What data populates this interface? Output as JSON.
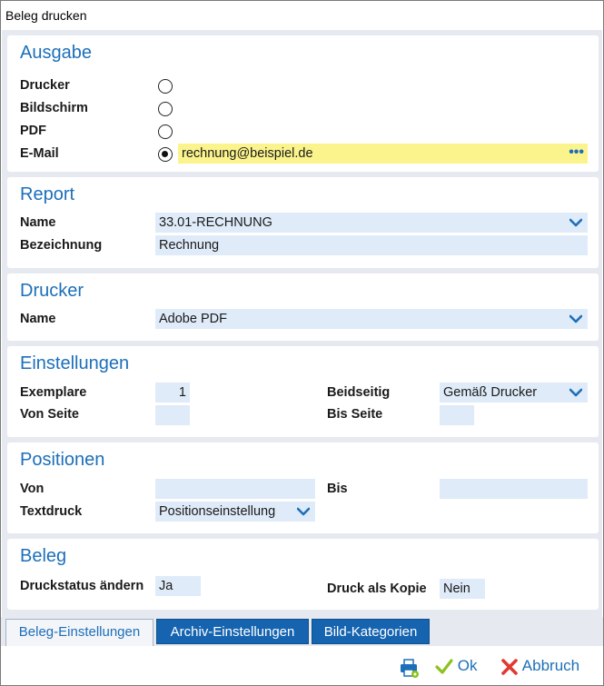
{
  "window": {
    "title": "Beleg drucken"
  },
  "ausgabe": {
    "title": "Ausgabe",
    "options": [
      {
        "label": "Drucker",
        "checked": false
      },
      {
        "label": "Bildschirm",
        "checked": false
      },
      {
        "label": "PDF",
        "checked": false
      },
      {
        "label": "E-Mail",
        "checked": true
      }
    ],
    "email_value": "rechnung@beispiel.de",
    "email_more": "•••"
  },
  "report": {
    "title": "Report",
    "name_label": "Name",
    "name_value": "33.01-RECHNUNG",
    "bezeichnung_label": "Bezeichnung",
    "bezeichnung_value": "Rechnung"
  },
  "drucker": {
    "title": "Drucker",
    "name_label": "Name",
    "name_value": "Adobe PDF"
  },
  "einstellungen": {
    "title": "Einstellungen",
    "exemplare_label": "Exemplare",
    "exemplare_value": "1",
    "von_seite_label": "Von Seite",
    "von_seite_value": "",
    "beidseitig_label": "Beidseitig",
    "beidseitig_value": "Gemäß Drucker",
    "bis_seite_label": "Bis Seite",
    "bis_seite_value": ""
  },
  "positionen": {
    "title": "Positionen",
    "von_label": "Von",
    "von_value": "",
    "bis_label": "Bis",
    "bis_value": "",
    "textdruck_label": "Textdruck",
    "textdruck_value": "Positionseinstellung"
  },
  "beleg": {
    "title": "Beleg",
    "druckstatus_label": "Druckstatus ändern",
    "druckstatus_value": "Ja",
    "kopie_label": "Druck als Kopie",
    "kopie_value": "Nein"
  },
  "tabs": [
    {
      "label": "Beleg-Einstellungen",
      "active": true
    },
    {
      "label": "Archiv-Einstellungen",
      "active": false
    },
    {
      "label": "Bild-Kategorien",
      "active": false
    }
  ],
  "buttons": {
    "ok_label": "Ok",
    "abbruch_label": "Abbruch"
  },
  "colors": {
    "accent": "#1c6fba",
    "field_bg": "#dfebf8",
    "highlight": "#fbf48d",
    "ok_green": "#8bc21c",
    "cancel_red": "#e03a2f"
  },
  "icons": [
    "chevron-down-icon",
    "more-dots-icon",
    "printer-settings-icon",
    "checkmark-icon",
    "close-x-icon"
  ]
}
